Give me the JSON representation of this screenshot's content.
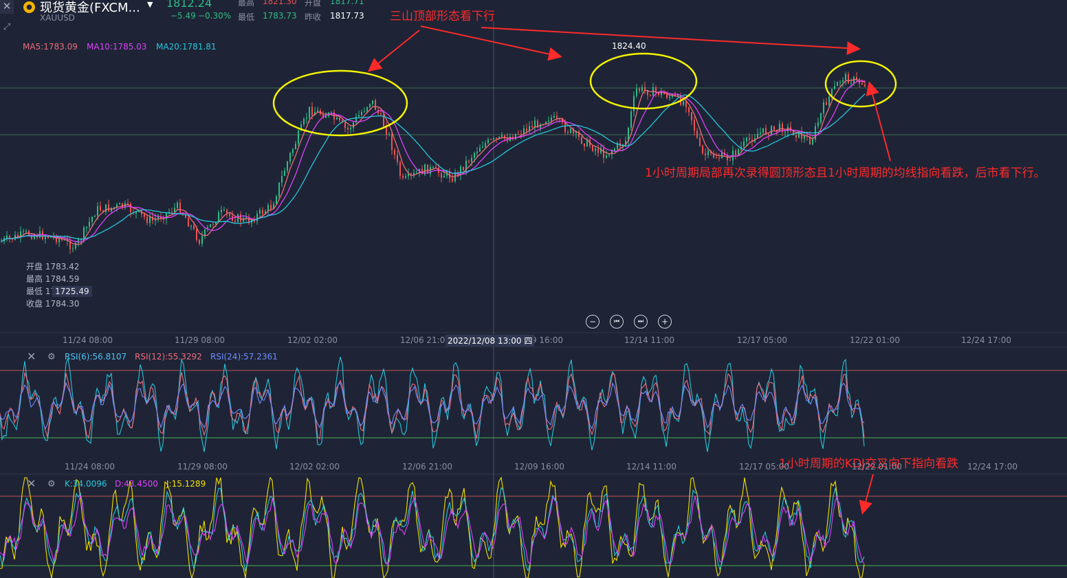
{
  "header": {
    "title": "现货黄金(FXCM...",
    "symbol": "XAUUSD",
    "price": "1812.24",
    "change": "−5.49",
    "change_pct": "−0.30%",
    "high_label": "最高",
    "high": "1821.30",
    "open_label": "开盘",
    "open": "1817.71",
    "low_label": "最低",
    "low": "1783.73",
    "prev_close_label": "昨收",
    "prev_close": "1817.73"
  },
  "ma": {
    "ma5": "MA5:1783.09",
    "ma10": "MA10:1785.03",
    "ma20": "MA20:1781.81"
  },
  "ohlc_popup": {
    "open": "开盘 1783.42",
    "high": "最高 1784.59",
    "low": "最低 1783.05",
    "close": "收盘 1784.30"
  },
  "price_tags": {
    "low_marker": "1725.49",
    "high_marker": "1824.40"
  },
  "xaxis": [
    "11/24 08:00",
    "11/29 08:00",
    "12/02 02:00",
    "12/06 21:00",
    "12/09 16:00",
    "12/14 11:00",
    "12/17 05:00",
    "12/22 01:00",
    "12/24 17:00"
  ],
  "crosshair_time": "2022/12/08 13:00 四",
  "rsi": {
    "rsi6": "RSI(6):56.8107",
    "rsi12": "RSI(12):55.3292",
    "rsi24": "RSI(24):57.2361"
  },
  "kdj": {
    "k": "K:34.0096",
    "d": "D:43.4500",
    "j": "J:15.1289"
  },
  "annotations": {
    "top": "三山顶部形态看下行",
    "mid": "1小时周期局部再次录得圆顶形态且1小时周期的均线指向看跌，后市看下行。",
    "kdj": "1小时周期的KDJ交叉向下指向看跌"
  },
  "colors": {
    "up": "#2ebd85",
    "down": "#ef5350",
    "ma5": "#f06b7a",
    "ma10": "#e040fb",
    "ma20": "#26c6da",
    "annotation": "#ff2a2a",
    "ellipse": "#f5f500"
  },
  "icons": [
    "close-icon",
    "expand-icon",
    "coin-icon",
    "dropdown-caret-icon",
    "zoom-out-icon",
    "step-back-icon",
    "step-forward-icon",
    "zoom-in-icon",
    "settings-icon"
  ],
  "controls": {
    "zoom_out": "−",
    "prev": "⏮",
    "next": "⏭",
    "zoom_in": "+"
  }
}
